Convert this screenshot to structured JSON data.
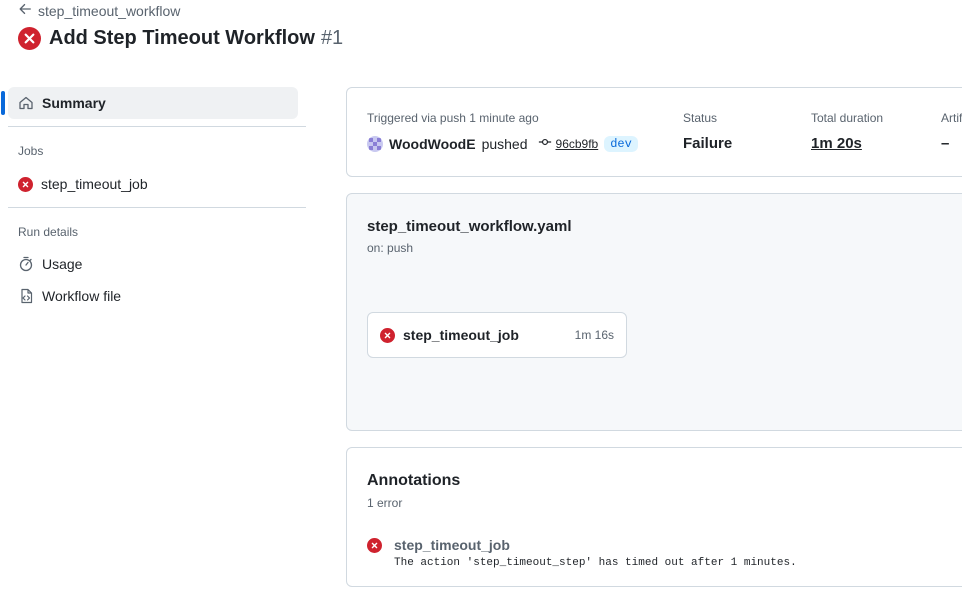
{
  "header": {
    "back_label": "step_timeout_workflow",
    "title": "Add Step Timeout Workflow",
    "run_number": "#1"
  },
  "sidebar": {
    "summary_label": "Summary",
    "jobs_heading": "Jobs",
    "job_label": "step_timeout_job",
    "run_details_heading": "Run details",
    "usage_label": "Usage",
    "workflow_file_label": "Workflow file"
  },
  "summary": {
    "trigger_text": "Triggered via push 1 minute ago",
    "actor": "WoodWoodE",
    "action": "pushed",
    "commit_sha": "96cb9fb",
    "branch": "dev",
    "status_label": "Status",
    "status_value": "Failure",
    "duration_label": "Total duration",
    "duration_value": "1m 20s",
    "artifacts_label": "Artifacts",
    "artifacts_value": "–"
  },
  "graph": {
    "file_name": "step_timeout_workflow.yaml",
    "trigger": "on: push",
    "job_name": "step_timeout_job",
    "job_duration": "1m 16s"
  },
  "annotations": {
    "title": "Annotations",
    "count": "1 error",
    "items": [
      {
        "job": "step_timeout_job",
        "message": "The action 'step_timeout_step' has timed out after 1 minutes."
      }
    ]
  },
  "colors": {
    "failure": "#cf222e",
    "accent": "#0969da",
    "muted": "#59636e",
    "border": "#d1d9e0"
  },
  "icons": [
    "arrow-left-icon",
    "x-circle-fill-icon",
    "home-icon",
    "stopwatch-icon",
    "file-code-icon",
    "git-commit-icon"
  ]
}
